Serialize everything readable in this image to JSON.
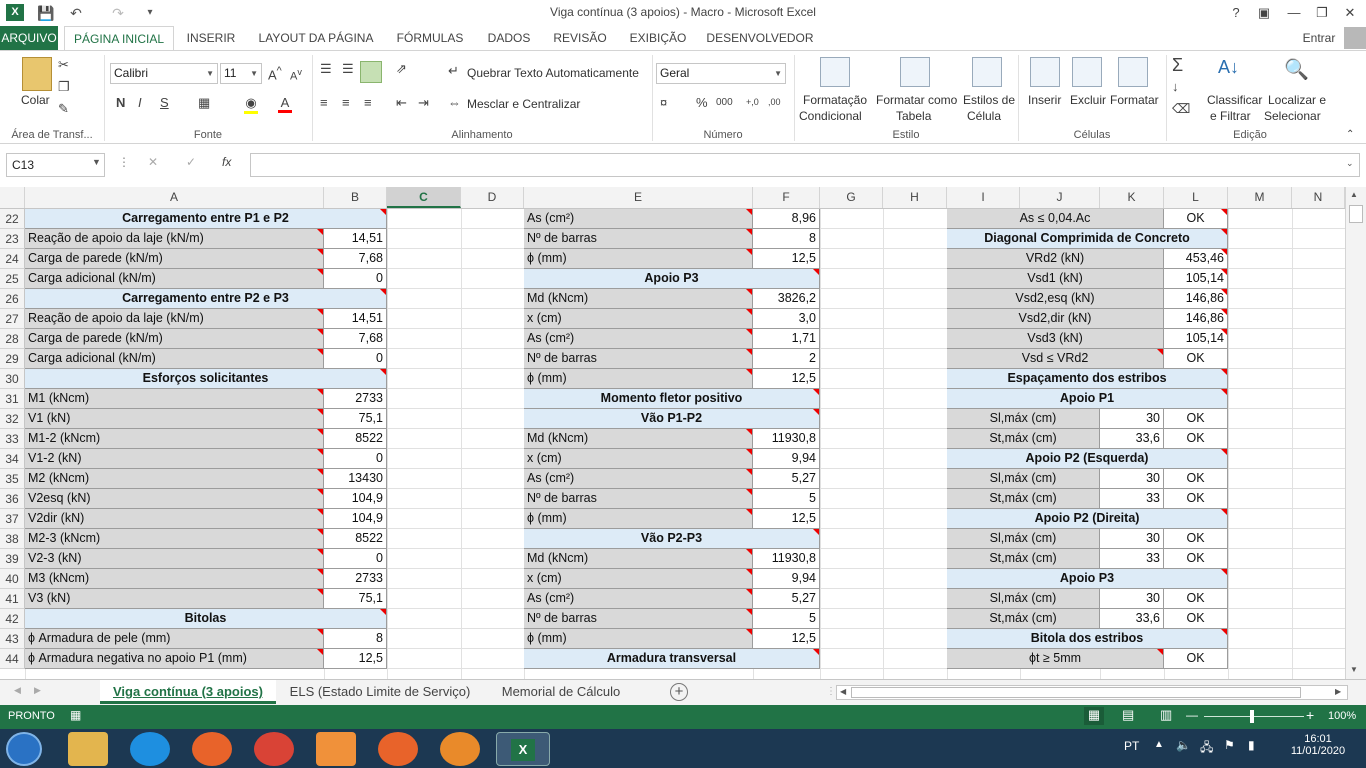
{
  "window": {
    "title": "Viga contínua (3 apoios) - Macro - Microsoft Excel",
    "signin": "Entrar"
  },
  "tabs": [
    "ARQUIVO",
    "PÁGINA INICIAL",
    "INSERIR",
    "LAYOUT DA PÁGINA",
    "FÓRMULAS",
    "DADOS",
    "REVISÃO",
    "EXIBIÇÃO",
    "DESENVOLVEDOR"
  ],
  "ribbon": {
    "clipboard": {
      "paste": "Colar",
      "group": "Área de Transf..."
    },
    "font": {
      "name": "Calibri",
      "size": "11",
      "bold": "N",
      "italic": "I",
      "underline": "S",
      "group": "Fonte"
    },
    "alignment": {
      "wrap": "Quebrar Texto Automaticamente",
      "merge": "Mesclar e Centralizar",
      "group": "Alinhamento"
    },
    "number": {
      "format": "Geral",
      "percent": "%",
      "thousands": "000",
      "group": "Número"
    },
    "styles": {
      "cond1": "Formatação",
      "cond2": "Condicional",
      "table1": "Formatar como",
      "table2": "Tabela",
      "cell1": "Estilos de",
      "cell2": "Célula",
      "group": "Estilo"
    },
    "cells": {
      "insert": "Inserir",
      "delete": "Excluir",
      "format": "Formatar",
      "group": "Células"
    },
    "editing": {
      "sort1": "Classificar",
      "sort2": "e Filtrar",
      "find1": "Localizar e",
      "find2": "Selecionar",
      "group": "Edição"
    }
  },
  "formula_bar": {
    "name_box": "C13",
    "fx": "fx",
    "value": ""
  },
  "columns": [
    "A",
    "B",
    "C",
    "D",
    "E",
    "F",
    "G",
    "H",
    "I",
    "J",
    "K",
    "L",
    "M",
    "N"
  ],
  "rows": [
    "22",
    "23",
    "24",
    "25",
    "26",
    "27",
    "28",
    "29",
    "30",
    "31",
    "32",
    "33",
    "34",
    "35",
    "36",
    "37",
    "38",
    "39",
    "40",
    "41",
    "42",
    "43",
    "44"
  ],
  "left_table": [
    [
      "hdr",
      "Carregamento entre P1 e P2",
      ""
    ],
    [
      "kv",
      "Reação de apoio da laje (kN/m)",
      "14,51"
    ],
    [
      "kv",
      "Carga de parede (kN/m)",
      "7,68"
    ],
    [
      "kv",
      "Carga adicional (kN/m)",
      "0"
    ],
    [
      "hdr",
      "Carregamento entre P2 e P3",
      ""
    ],
    [
      "kv",
      "Reação de apoio da laje (kN/m)",
      "14,51"
    ],
    [
      "kv",
      "Carga de parede (kN/m)",
      "7,68"
    ],
    [
      "kv",
      "Carga adicional (kN/m)",
      "0"
    ],
    [
      "hdr",
      "Esforços solicitantes",
      ""
    ],
    [
      "kv",
      "M1 (kNcm)",
      "2733"
    ],
    [
      "kv",
      "V1 (kN)",
      "75,1"
    ],
    [
      "kv",
      "M1-2 (kNcm)",
      "8522"
    ],
    [
      "kv",
      "V1-2 (kN)",
      "0"
    ],
    [
      "kv",
      "M2 (kNcm)",
      "13430"
    ],
    [
      "kv",
      "V2esq (kN)",
      "104,9"
    ],
    [
      "kv",
      "V2dir (kN)",
      "104,9"
    ],
    [
      "kv",
      "M2-3 (kNcm)",
      "8522"
    ],
    [
      "kv",
      "V2-3 (kN)",
      "0"
    ],
    [
      "kv",
      "M3 (kNcm)",
      "2733"
    ],
    [
      "kv",
      "V3 (kN)",
      "75,1"
    ],
    [
      "hdr",
      "Bitolas",
      ""
    ],
    [
      "kv",
      "ϕ Armadura de pele (mm)",
      "8"
    ],
    [
      "kv",
      "ϕ Armadura negativa no apoio P1 (mm)",
      "12,5"
    ]
  ],
  "mid_table": [
    [
      "kv",
      "As (cm²)",
      "8,96"
    ],
    [
      "kv",
      "Nº de barras",
      "8"
    ],
    [
      "kv",
      "ϕ (mm)",
      "12,5"
    ],
    [
      "hdr",
      "Apoio P3",
      ""
    ],
    [
      "kv",
      "Md (kNcm)",
      "3826,2"
    ],
    [
      "kv",
      "x (cm)",
      "3,0"
    ],
    [
      "kv",
      "As (cm²)",
      "1,71"
    ],
    [
      "kv",
      "Nº de barras",
      "2"
    ],
    [
      "kv",
      "ϕ (mm)",
      "12,5"
    ],
    [
      "hdr",
      "Momento fletor positivo",
      ""
    ],
    [
      "hdr",
      "Vão P1-P2",
      ""
    ],
    [
      "kv",
      "Md (kNcm)",
      "11930,8"
    ],
    [
      "kv",
      "x (cm)",
      "9,94"
    ],
    [
      "kv",
      "As (cm²)",
      "5,27"
    ],
    [
      "kv",
      "Nº de barras",
      "5"
    ],
    [
      "kv",
      "ϕ (mm)",
      "12,5"
    ],
    [
      "hdr",
      "Vão P2-P3",
      ""
    ],
    [
      "kv",
      "Md (kNcm)",
      "11930,8"
    ],
    [
      "kv",
      "x (cm)",
      "9,94"
    ],
    [
      "kv",
      "As (cm²)",
      "5,27"
    ],
    [
      "kv",
      "Nº de barras",
      "5"
    ],
    [
      "kv",
      "ϕ (mm)",
      "12,5"
    ],
    [
      "hdr",
      "Armadura transversal",
      ""
    ]
  ],
  "right_table": [
    [
      "kv",
      "As ≤ 0,04.Ac",
      "OK"
    ],
    [
      "hdr",
      "Diagonal Comprimida de Concreto",
      ""
    ],
    [
      "kv",
      "VRd2 (kN)",
      "453,46"
    ],
    [
      "kv",
      "Vsd1 (kN)",
      "105,14"
    ],
    [
      "kv",
      "Vsd2,esq (kN)",
      "146,86"
    ],
    [
      "kv",
      "Vsd2,dir (kN)",
      "146,86"
    ],
    [
      "kv",
      "Vsd3 (kN)",
      "105,14"
    ],
    [
      "kvok",
      "Vsd ≤ VRd2",
      "OK"
    ],
    [
      "hdr",
      "Espaçamento dos estribos",
      ""
    ],
    [
      "hdr",
      "Apoio P1",
      ""
    ],
    [
      "k3",
      "Sl,máx (cm)",
      "30",
      "OK"
    ],
    [
      "k3",
      "St,máx (cm)",
      "33,6",
      "OK"
    ],
    [
      "hdr",
      "Apoio P2 (Esquerda)",
      ""
    ],
    [
      "k3",
      "Sl,máx (cm)",
      "30",
      "OK"
    ],
    [
      "k3",
      "St,máx (cm)",
      "33",
      "OK"
    ],
    [
      "hdr",
      "Apoio P2 (Direita)",
      ""
    ],
    [
      "k3",
      "Sl,máx (cm)",
      "30",
      "OK"
    ],
    [
      "k3",
      "St,máx (cm)",
      "33",
      "OK"
    ],
    [
      "hdr",
      "Apoio P3",
      ""
    ],
    [
      "k3",
      "Sl,máx (cm)",
      "30",
      "OK"
    ],
    [
      "k3",
      "St,máx (cm)",
      "33,6",
      "OK"
    ],
    [
      "hdr",
      "Bitola dos estribos",
      ""
    ],
    [
      "kvok",
      "ϕt ≥ 5mm",
      "OK"
    ]
  ],
  "sheet_tabs": [
    "Viga contínua (3 apoios)",
    "ELS (Estado Limite de Serviço)",
    "Memorial de Cálculo"
  ],
  "status": {
    "mode": "PRONTO",
    "zoom": "100%"
  },
  "taskbar": {
    "lang": "PT",
    "time": "16:01",
    "date": "11/01/2020"
  },
  "colors": {
    "excel_green": "#217346",
    "header_fill": "#ddebf7",
    "label_fill": "#d9d9d9",
    "comment_marker": "#e00000"
  }
}
